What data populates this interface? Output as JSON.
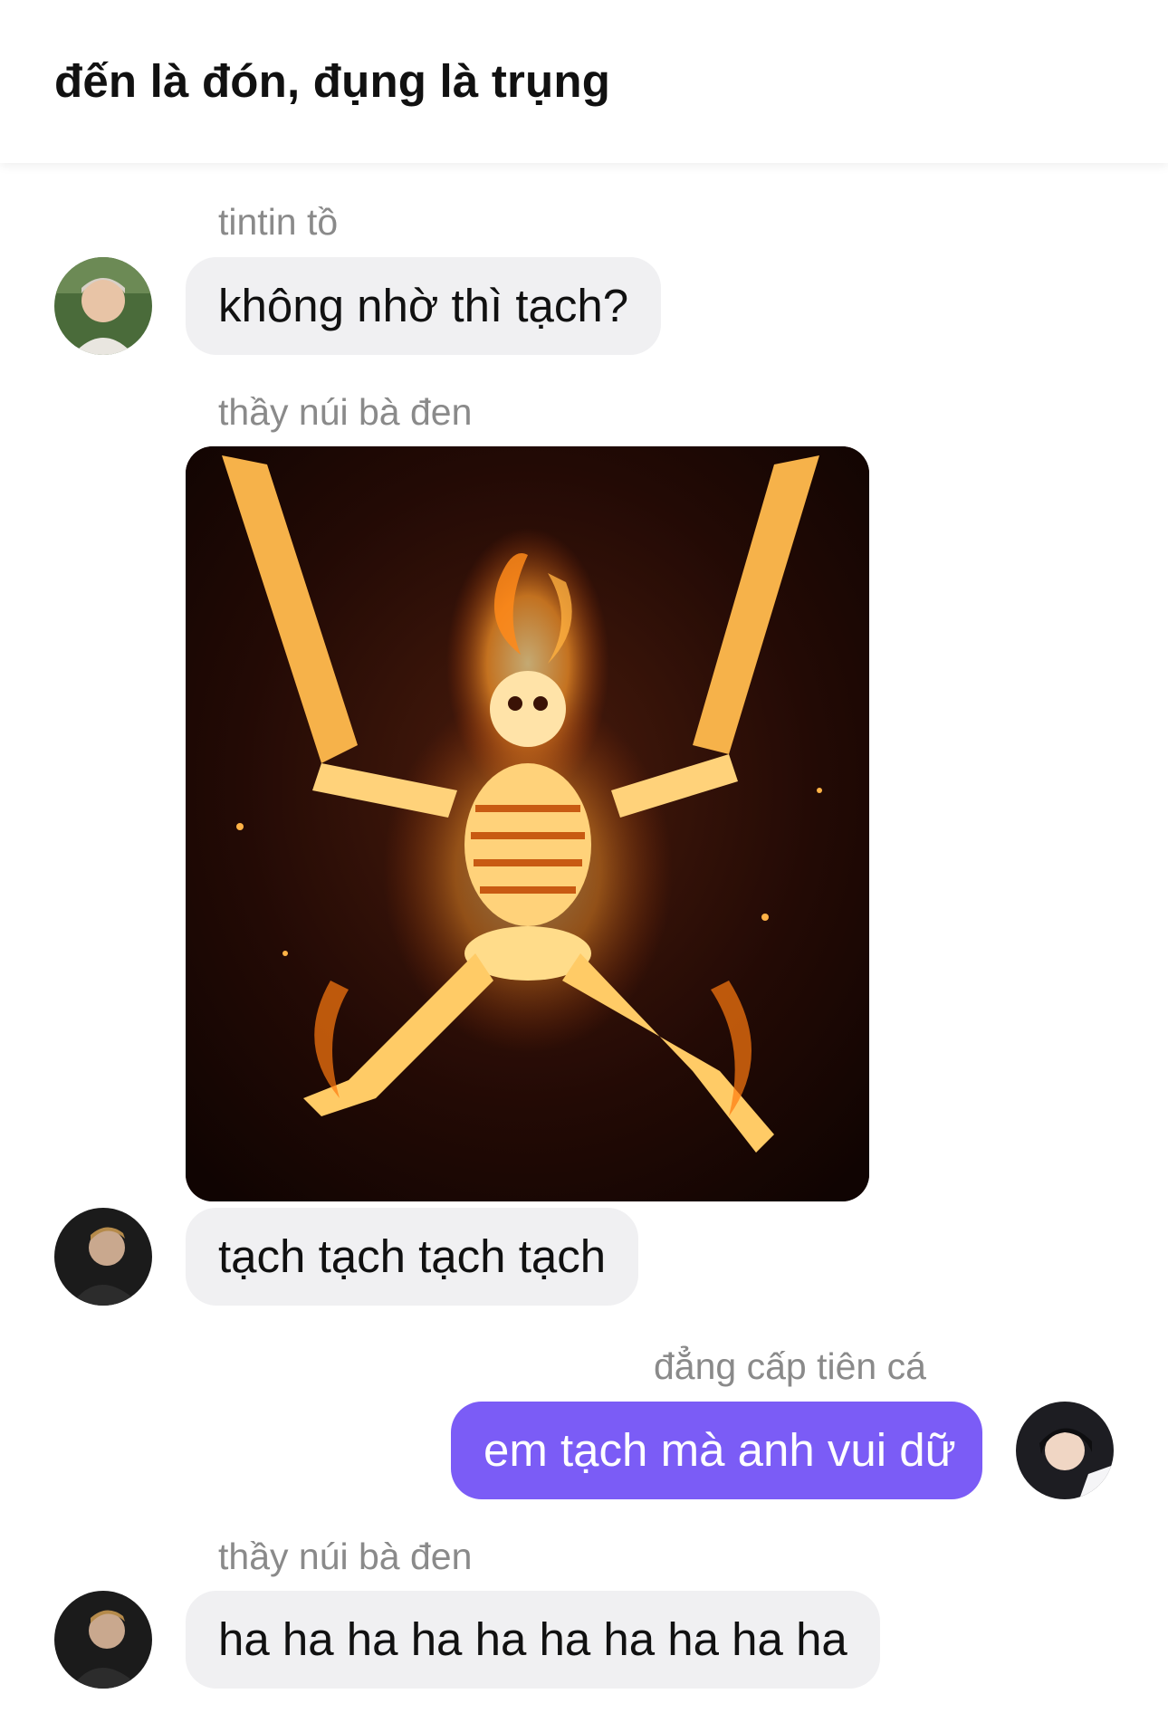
{
  "header": {
    "title": "đến là đón, đụng là trụng"
  },
  "messages": [
    {
      "sender": "tintin tồ",
      "text": "không nhờ thì tạch?"
    },
    {
      "sender": "thầy núi bà đen",
      "image": "flaming-skeleton-photo",
      "text": "tạch tạch tạch tạch"
    },
    {
      "sender": "đẳng cấp tiên cá",
      "text": "em tạch mà anh vui dữ"
    },
    {
      "sender": "thầy núi bà đen",
      "text": "ha ha ha ha ha ha ha ha ha ha"
    }
  ],
  "colors": {
    "incoming_bubble": "#f0f0f2",
    "outgoing_bubble": "#7b5cf6",
    "sender_name": "#8a8a8a",
    "text": "#111111"
  }
}
